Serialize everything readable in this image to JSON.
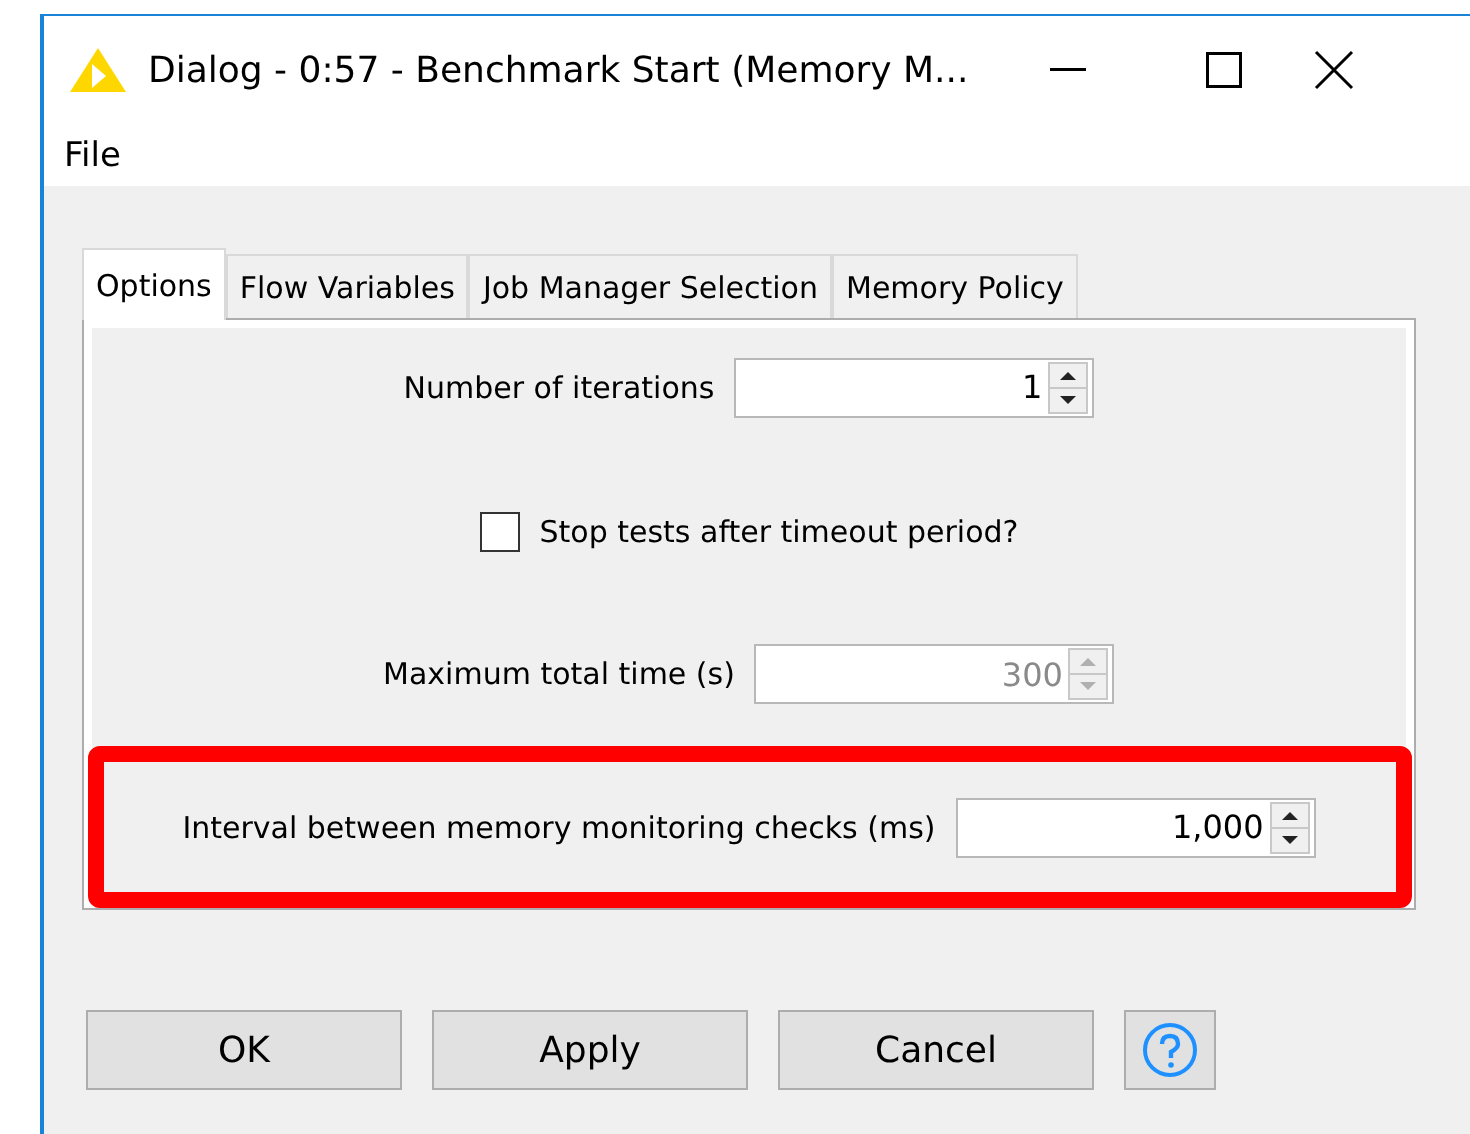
{
  "window": {
    "title": "Dialog - 0:57 - Benchmark Start (Memory M..."
  },
  "menu": [
    "File"
  ],
  "tabs": [
    {
      "label": "Options",
      "selected": true
    },
    {
      "label": "Flow Variables",
      "selected": false
    },
    {
      "label": "Job Manager Selection",
      "selected": false
    },
    {
      "label": "Memory Policy",
      "selected": false
    }
  ],
  "fields": [
    {
      "kind": "spinner",
      "label": "Number of iterations",
      "value": "1",
      "disabled": false,
      "highlighted": false
    },
    {
      "kind": "checkbox",
      "label": "Stop tests after timeout period?",
      "checked": false,
      "highlighted": false
    },
    {
      "kind": "spinner",
      "label": "Maximum total time (s)",
      "value": "300",
      "disabled": true,
      "highlighted": false
    },
    {
      "kind": "spinner",
      "label": "Interval between memory monitoring checks (ms)",
      "value": "1,000",
      "disabled": false,
      "highlighted": true
    }
  ],
  "buttons": [
    "OK",
    "Apply",
    "Cancel"
  ]
}
